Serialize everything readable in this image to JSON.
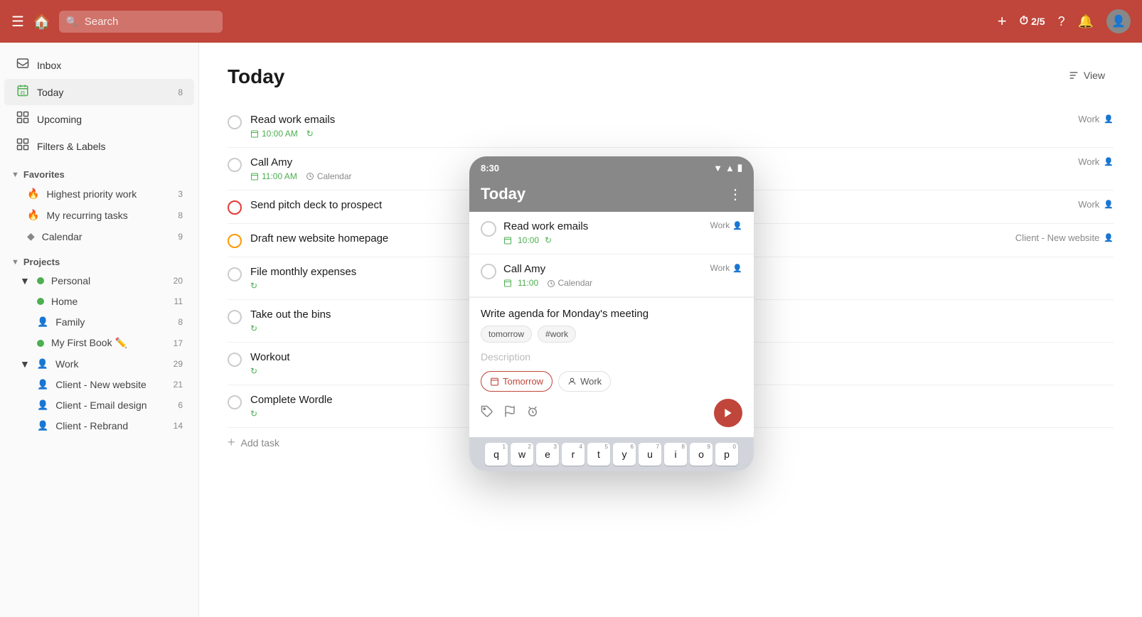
{
  "topnav": {
    "search_placeholder": "Search",
    "focus_label": "2/5",
    "add_label": "+",
    "help_label": "?",
    "bell_label": "🔔"
  },
  "sidebar": {
    "nav_items": [
      {
        "id": "inbox",
        "label": "Inbox",
        "icon": "📥",
        "badge": ""
      },
      {
        "id": "today",
        "label": "Today",
        "icon": "📅",
        "badge": "8",
        "active": true
      },
      {
        "id": "upcoming",
        "label": "Upcoming",
        "icon": "⬛",
        "badge": ""
      },
      {
        "id": "filters",
        "label": "Filters & Labels",
        "icon": "⬛",
        "badge": ""
      }
    ],
    "favorites_label": "Favorites",
    "favorites": [
      {
        "id": "highest-priority",
        "label": "Highest priority work",
        "icon": "🔴",
        "badge": "3"
      },
      {
        "id": "recurring",
        "label": "My recurring tasks",
        "icon": "🟠",
        "badge": "8"
      },
      {
        "id": "calendar",
        "label": "Calendar",
        "icon": "◆",
        "badge": "9"
      }
    ],
    "projects_label": "Projects",
    "personal_label": "Personal",
    "personal_badge": "20",
    "personal_projects": [
      {
        "id": "home",
        "label": "Home",
        "dot": "green",
        "badge": "11"
      },
      {
        "id": "family",
        "label": "Family",
        "dot": "person",
        "badge": "8"
      },
      {
        "id": "firstbook",
        "label": "My First Book ✏️",
        "dot": "green",
        "badge": "17"
      }
    ],
    "work_label": "Work",
    "work_badge": "29",
    "work_projects": [
      {
        "id": "client-new-website",
        "label": "Client - New website",
        "dot": "purple",
        "badge": "21"
      },
      {
        "id": "client-email",
        "label": "Client - Email design",
        "dot": "purple",
        "badge": "6"
      },
      {
        "id": "client-rebrand",
        "label": "Client - Rebrand",
        "dot": "purple",
        "badge": "14"
      }
    ]
  },
  "main": {
    "title": "Today",
    "view_label": "View",
    "tasks": [
      {
        "id": 1,
        "name": "Read work emails",
        "time": "10:00 AM",
        "recur": true,
        "priority": "normal",
        "tag": "Work",
        "person": true
      },
      {
        "id": 2,
        "name": "Call Amy",
        "time": "11:00 AM",
        "calendar": "Calendar",
        "priority": "normal",
        "tag": "Work",
        "person": true
      },
      {
        "id": 3,
        "name": "Send pitch deck to prospect",
        "time": "",
        "priority": "high",
        "tag": "Work",
        "person": true
      },
      {
        "id": 4,
        "name": "Draft new website homepage",
        "time": "",
        "priority": "med",
        "tag": "Client - New website",
        "person": true
      },
      {
        "id": 5,
        "name": "File monthly expenses",
        "time": "",
        "recur": true,
        "priority": "normal",
        "tag": "",
        "person": false
      },
      {
        "id": 6,
        "name": "Take out the bins",
        "time": "",
        "recur": true,
        "priority": "normal",
        "tag": "",
        "person": false
      },
      {
        "id": 7,
        "name": "Workout",
        "time": "",
        "recur": true,
        "priority": "normal",
        "tag": "",
        "person": false
      },
      {
        "id": 8,
        "name": "Complete Wordle",
        "time": "",
        "recur": true,
        "priority": "normal",
        "tag": "",
        "person": false
      }
    ],
    "add_task_label": "Add task"
  },
  "mobile": {
    "time": "8:30",
    "title": "Today",
    "tasks": [
      {
        "id": 1,
        "name": "Read work emails",
        "time": "10:00",
        "recur": true,
        "tag": "Work",
        "person": true
      },
      {
        "id": 2,
        "name": "Call Amy",
        "time": "11:00",
        "calendar": "Calendar",
        "tag": "Work",
        "person": true
      }
    ],
    "quick_add": {
      "text": "Write agenda for Monday's meeting",
      "tags": [
        "tomorrow",
        "#work"
      ],
      "description_placeholder": "Description",
      "date_btn": "Tomorrow",
      "project_btn": "Work"
    },
    "keyboard": {
      "rows": [
        [
          {
            "key": "q",
            "num": "1"
          },
          {
            "key": "w",
            "num": "2"
          },
          {
            "key": "e",
            "num": "3"
          },
          {
            "key": "r",
            "num": "4"
          },
          {
            "key": "t",
            "num": "5"
          },
          {
            "key": "y",
            "num": "6"
          },
          {
            "key": "u",
            "num": "7"
          },
          {
            "key": "i",
            "num": "8"
          },
          {
            "key": "o",
            "num": "9"
          },
          {
            "key": "p",
            "num": "0"
          }
        ]
      ]
    }
  },
  "colors": {
    "brand": "#c0453a",
    "green": "#4caf50",
    "orange": "#ff9800",
    "red": "#e53935",
    "purple": "#a855f7"
  }
}
